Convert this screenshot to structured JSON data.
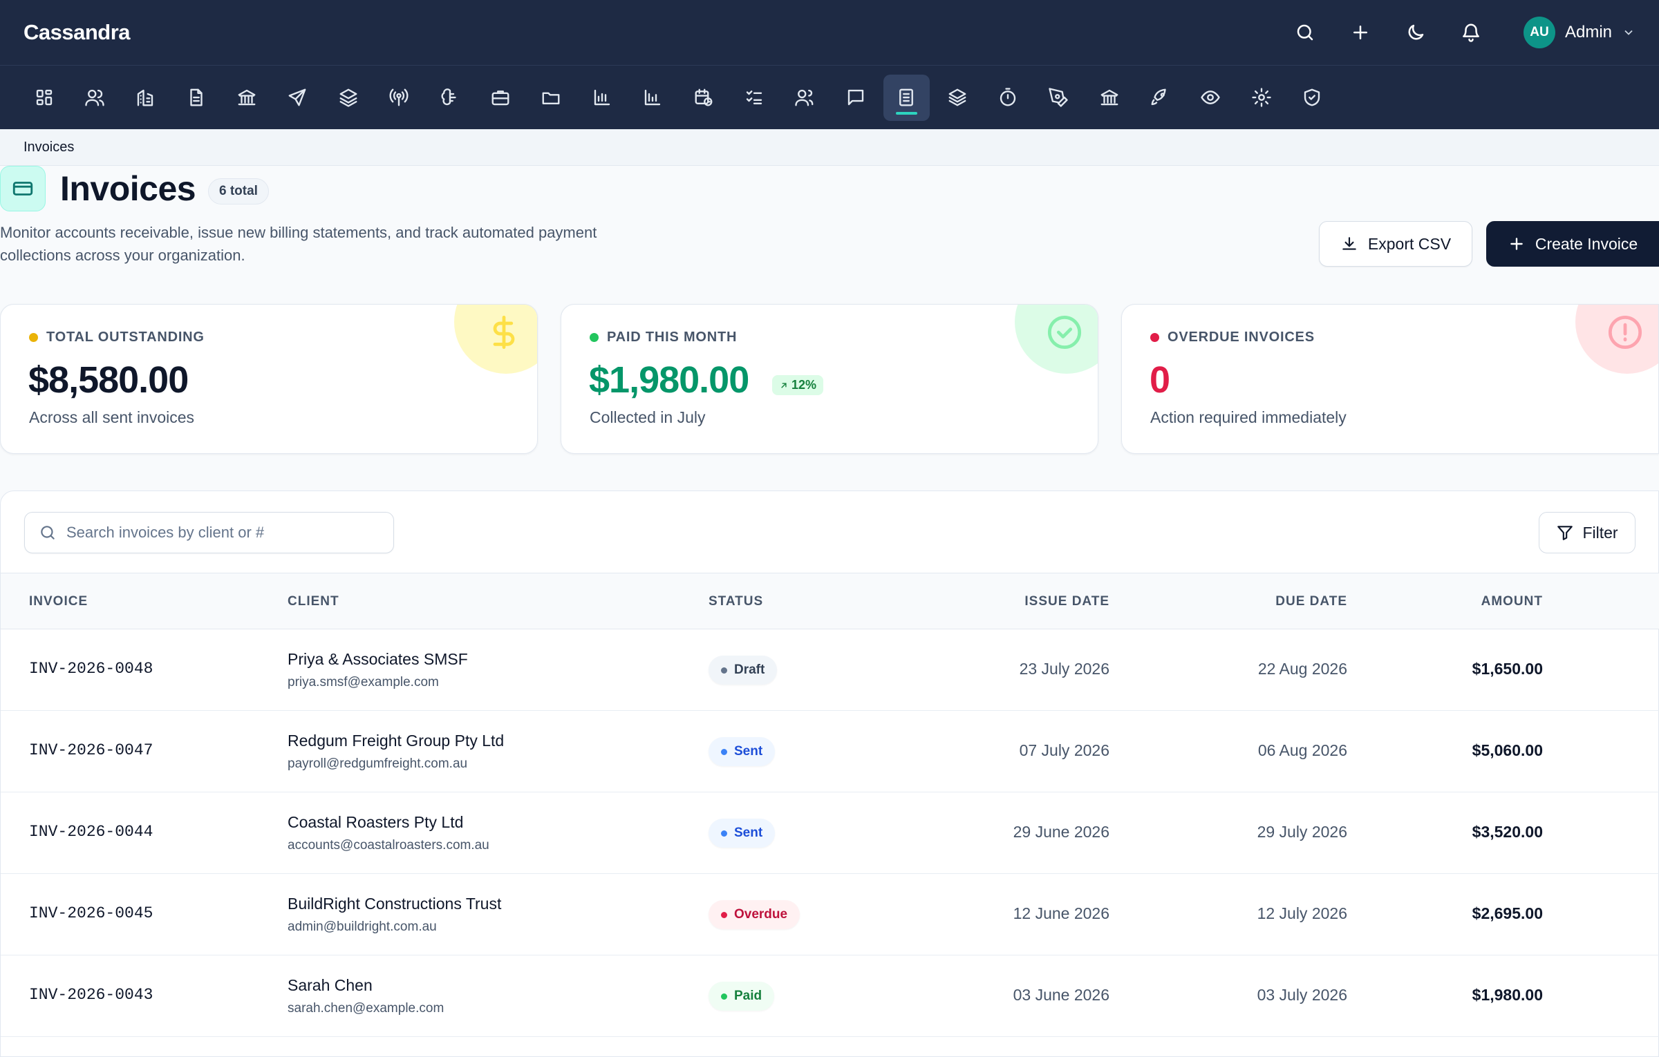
{
  "app": {
    "name": "Cassandra"
  },
  "topbar": {
    "icons": [
      "search-icon",
      "plus-icon",
      "moon-icon",
      "bell-icon"
    ],
    "user": {
      "initials": "AU",
      "name": "Admin"
    }
  },
  "nav": {
    "items": [
      {
        "icon": "dashboard-icon"
      },
      {
        "icon": "users-icon"
      },
      {
        "icon": "building-icon"
      },
      {
        "icon": "document-icon"
      },
      {
        "icon": "bank-icon"
      },
      {
        "icon": "send-icon"
      },
      {
        "icon": "layers-icon"
      },
      {
        "icon": "broadcast-icon"
      },
      {
        "icon": "brain-icon"
      },
      {
        "icon": "briefcase-icon"
      },
      {
        "icon": "folder-icon"
      },
      {
        "icon": "bar-chart-icon"
      },
      {
        "icon": "bar-chart-alt-icon"
      },
      {
        "icon": "calendar-clock-icon"
      },
      {
        "icon": "checklist-icon"
      },
      {
        "icon": "team-icon"
      },
      {
        "icon": "message-icon"
      },
      {
        "icon": "invoice-icon",
        "active": true
      },
      {
        "icon": "stack-icon"
      },
      {
        "icon": "timer-icon"
      },
      {
        "icon": "pen-tool-icon"
      },
      {
        "icon": "institution-icon"
      },
      {
        "icon": "rocket-icon"
      },
      {
        "icon": "eye-icon"
      },
      {
        "icon": "gear-icon"
      },
      {
        "icon": "shield-check-icon"
      }
    ],
    "active_color": "#2dd4bf"
  },
  "breadcrumb": {
    "current": "Invoices"
  },
  "header": {
    "title": "Invoices",
    "badge": "6 total",
    "subtitle": "Monitor accounts receivable, issue new billing statements, and track automated payment collections across your organization.",
    "export_label": "Export CSV",
    "create_label": "Create Invoice"
  },
  "stats": [
    {
      "label": "TOTAL OUTSTANDING",
      "value": "$8,580.00",
      "desc": "Across all sent invoices",
      "color": "#eab308",
      "value_color": "#0f172a",
      "icon": "dollar-icon"
    },
    {
      "label": "PAID THIS MONTH",
      "value": "$1,980.00",
      "desc": "Collected in July",
      "trend": "12%",
      "color": "#22c55e",
      "value_color": "#059669",
      "icon": "check-circle-icon"
    },
    {
      "label": "OVERDUE INVOICES",
      "value": "0",
      "desc": "Action required immediately",
      "color": "#e11d48",
      "value_color": "#e11d48",
      "icon": "alert-circle-icon"
    }
  ],
  "table": {
    "search_placeholder": "Search invoices by client or #",
    "filter_label": "Filter",
    "columns": [
      "INVOICE",
      "CLIENT",
      "STATUS",
      "ISSUE DATE",
      "DUE DATE",
      "AMOUNT"
    ],
    "rows": [
      {
        "invoice": "INV-2026-0048",
        "client": "Priya & Associates SMSF",
        "email": "priya.smsf@example.com",
        "status": "Draft",
        "issue": "23 July 2026",
        "due": "22 Aug 2026",
        "amount": "$1,650.00"
      },
      {
        "invoice": "INV-2026-0047",
        "client": "Redgum Freight Group Pty Ltd",
        "email": "payroll@redgumfreight.com.au",
        "status": "Sent",
        "issue": "07 July 2026",
        "due": "06 Aug 2026",
        "amount": "$5,060.00"
      },
      {
        "invoice": "INV-2026-0044",
        "client": "Coastal Roasters Pty Ltd",
        "email": "accounts@coastalroasters.com.au",
        "status": "Sent",
        "issue": "29 June 2026",
        "due": "29 July 2026",
        "amount": "$3,520.00"
      },
      {
        "invoice": "INV-2026-0045",
        "client": "BuildRight Constructions Trust",
        "email": "admin@buildright.com.au",
        "status": "Overdue",
        "issue": "12 June 2026",
        "due": "12 July 2026",
        "amount": "$2,695.00"
      },
      {
        "invoice": "INV-2026-0043",
        "client": "Sarah Chen",
        "email": "sarah.chen@example.com",
        "status": "Paid",
        "issue": "03 June 2026",
        "due": "03 July 2026",
        "amount": "$1,980.00"
      }
    ]
  },
  "status_colors": {
    "Draft": {
      "bg": "#f1f5f9",
      "fg": "#334155",
      "dot": "#64748b"
    },
    "Sent": {
      "bg": "#eff6ff",
      "fg": "#1d4ed8",
      "dot": "#3b82f6"
    },
    "Overdue": {
      "bg": "#fff1f2",
      "fg": "#be123c",
      "dot": "#e11d48"
    },
    "Paid": {
      "bg": "#f0fdf4",
      "fg": "#15803d",
      "dot": "#22c55e"
    }
  }
}
